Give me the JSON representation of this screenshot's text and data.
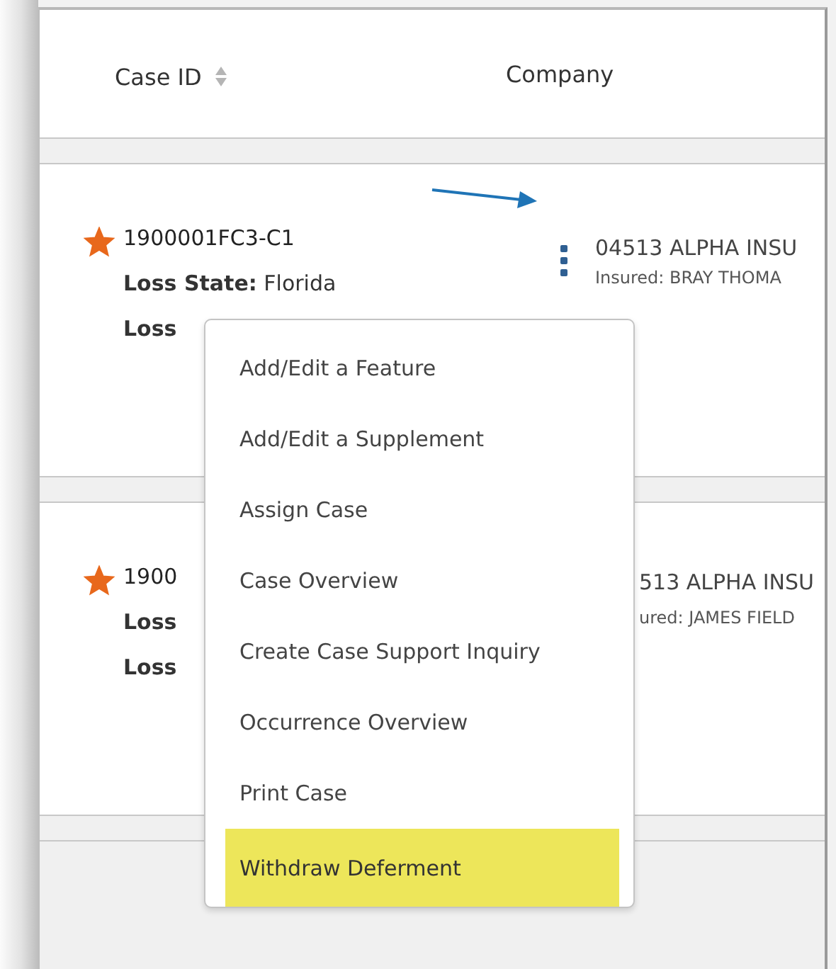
{
  "table": {
    "columns": [
      {
        "label": "Case ID",
        "sortable": true
      },
      {
        "label": "Company",
        "sortable": false
      }
    ],
    "rows": [
      {
        "starred": true,
        "case_id": "1900001FC3-C1",
        "lines": [
          "**Loss State:** Florida",
          "**Loss**"
        ],
        "has_actions": true,
        "company": "04513 ALPHA INSU",
        "insured": "Insured: BRAY THOMA"
      },
      {
        "starred": true,
        "case_id": "1900",
        "lines": [
          "**Loss**",
          "**Loss**"
        ],
        "has_actions": false,
        "company": "513 ALPHA INSU",
        "insured": "ured: JAMES FIELD"
      }
    ]
  },
  "context_menu": {
    "items": [
      {
        "label": "Add/Edit a Feature",
        "selected": false
      },
      {
        "label": "Add/Edit a Supplement",
        "selected": false
      },
      {
        "label": "Assign Case",
        "selected": false
      },
      {
        "label": "Case Overview",
        "selected": false
      },
      {
        "label": "Create Case Support Inquiry",
        "selected": false
      },
      {
        "label": "Occurrence Overview",
        "selected": false
      },
      {
        "label": "Print Case",
        "selected": false
      },
      {
        "label": "Withdraw Deferment",
        "selected": true
      }
    ]
  }
}
